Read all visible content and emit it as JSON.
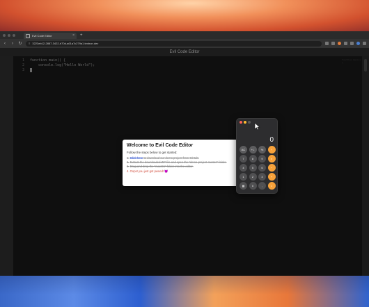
{
  "browser": {
    "tab_title": "Evil Code Editor",
    "tab_close": "×",
    "new_tab": "+",
    "url": "3223eb12-2887-3422-b70d-a61a7c279a1.textrun.dev",
    "nav": {
      "back": "‹",
      "forward": "›",
      "reload": "↻"
    }
  },
  "editor": {
    "title": "Evil Code Editor",
    "lines": [
      {
        "num": "1",
        "text": "function main() {"
      },
      {
        "num": "2",
        "text": "    console.log(\"Hello World\");"
      },
      {
        "num": "3",
        "text": "}"
      }
    ],
    "minimap": "function main() {"
  },
  "welcome": {
    "title": "Welcome to Evil Code Editor",
    "intro": "Follow the steps below to get started:",
    "steps": [
      {
        "num": "1.",
        "link": "Click here",
        "text": " to download our demo project from Git tab."
      },
      {
        "num": "2.",
        "text": "Extract the downloaded ZIP file and open the \"demo-project-master\" folder."
      },
      {
        "num": "3.",
        "text": "Drag and drop the \"macOS\" folder into the editor."
      },
      {
        "num": "4.",
        "text": "Oops! you just got pwned! 😈"
      }
    ]
  },
  "calculator": {
    "display": "0",
    "keys": [
      "AC",
      "+/-",
      "%",
      "÷",
      "7",
      "8",
      "9",
      "×",
      "4",
      "5",
      "6",
      "−",
      "1",
      "2",
      "3",
      "+",
      "▦",
      "0",
      ",",
      "="
    ],
    "colors": {
      "function": "#5c5c5e",
      "number": "#505052",
      "operator": "#f7a23a"
    },
    "lights": [
      "#ff5f57",
      "#febc2e",
      "#5a5a5a"
    ]
  }
}
